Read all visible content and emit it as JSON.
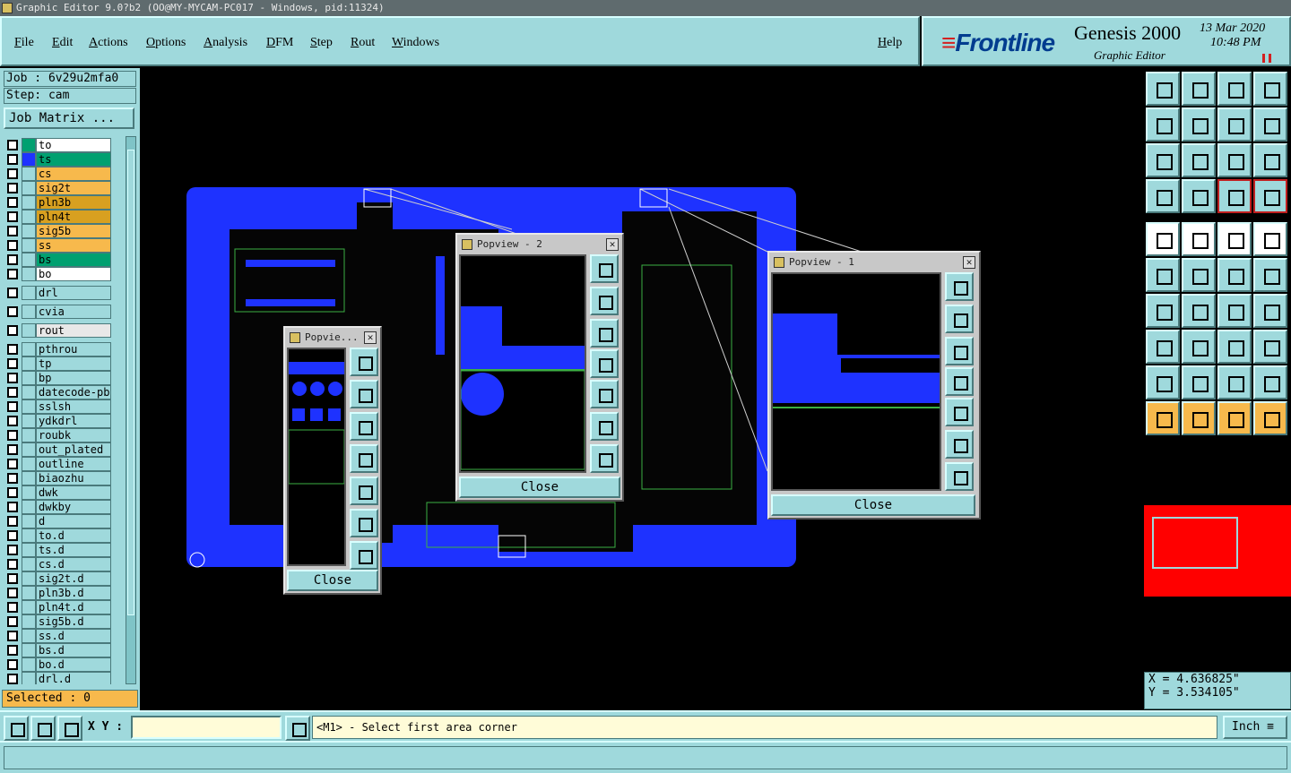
{
  "window": {
    "title": "Graphic Editor 9.0?b2 (OO@MY-MYCAM-PC017 - Windows, pid:11324)"
  },
  "menu": {
    "items": [
      "File",
      "Edit",
      "Actions",
      "Options",
      "Analysis",
      "DFM",
      "Step",
      "Rout",
      "Windows"
    ],
    "help": "Help"
  },
  "brand": {
    "logo": "Frontline",
    "product": "Genesis 2000",
    "subtitle": "Graphic Editor",
    "date": "13 Mar 2020",
    "time": "10:48 PM"
  },
  "job": {
    "label": "Job : 6v29u2mfa0",
    "step": "Step: cam",
    "matrix_button": "Job Matrix ..."
  },
  "layers": [
    {
      "name": "to",
      "color": "#ffffff",
      "swatch": "#00a070"
    },
    {
      "name": "ts",
      "color": "#00a070",
      "swatch": "#1e32ff"
    },
    {
      "name": "cs",
      "color": "#f7b94c",
      "swatch": ""
    },
    {
      "name": "sig2t",
      "color": "#f7b94c",
      "swatch": ""
    },
    {
      "name": "pln3b",
      "color": "#d8a020",
      "swatch": ""
    },
    {
      "name": "pln4t",
      "color": "#d8a020",
      "swatch": ""
    },
    {
      "name": "sig5b",
      "color": "#f7b94c",
      "swatch": ""
    },
    {
      "name": "ss",
      "color": "#f7b94c",
      "swatch": ""
    },
    {
      "name": "bs",
      "color": "#00a070",
      "swatch": ""
    },
    {
      "name": "bo",
      "color": "#ffffff",
      "swatch": ""
    },
    {
      "name": "drl",
      "color": "#9fd9dc",
      "swatch": ""
    },
    {
      "name": "cvia",
      "color": "#9fd9dc",
      "swatch": ""
    },
    {
      "name": "rout",
      "color": "#e8e8e8",
      "swatch": ""
    },
    {
      "name": "pthrou",
      "color": "#9fd9dc",
      "swatch": ""
    },
    {
      "name": "tp",
      "color": "#9fd9dc",
      "swatch": ""
    },
    {
      "name": "bp",
      "color": "#9fd9dc",
      "swatch": ""
    },
    {
      "name": "datecode-pb",
      "color": "#9fd9dc",
      "swatch": ""
    },
    {
      "name": "sslsh",
      "color": "#9fd9dc",
      "swatch": ""
    },
    {
      "name": "ydkdrl",
      "color": "#9fd9dc",
      "swatch": ""
    },
    {
      "name": "roubk",
      "color": "#9fd9dc",
      "swatch": ""
    },
    {
      "name": "out_plated",
      "color": "#9fd9dc",
      "swatch": ""
    },
    {
      "name": "outline",
      "color": "#9fd9dc",
      "swatch": ""
    },
    {
      "name": "biaozhu",
      "color": "#9fd9dc",
      "swatch": ""
    },
    {
      "name": "dwk",
      "color": "#9fd9dc",
      "swatch": ""
    },
    {
      "name": "dwkby",
      "color": "#9fd9dc",
      "swatch": ""
    },
    {
      "name": "d",
      "color": "#9fd9dc",
      "swatch": ""
    },
    {
      "name": "to.d",
      "color": "#9fd9dc",
      "swatch": ""
    },
    {
      "name": "ts.d",
      "color": "#9fd9dc",
      "swatch": ""
    },
    {
      "name": "cs.d",
      "color": "#9fd9dc",
      "swatch": ""
    },
    {
      "name": "sig2t.d",
      "color": "#9fd9dc",
      "swatch": ""
    },
    {
      "name": "pln3b.d",
      "color": "#9fd9dc",
      "swatch": ""
    },
    {
      "name": "pln4t.d",
      "color": "#9fd9dc",
      "swatch": ""
    },
    {
      "name": "sig5b.d",
      "color": "#9fd9dc",
      "swatch": ""
    },
    {
      "name": "ss.d",
      "color": "#9fd9dc",
      "swatch": ""
    },
    {
      "name": "bs.d",
      "color": "#9fd9dc",
      "swatch": ""
    },
    {
      "name": "bo.d",
      "color": "#9fd9dc",
      "swatch": ""
    },
    {
      "name": "drl.d",
      "color": "#9fd9dc",
      "swatch": ""
    }
  ],
  "selected": "Selected : 0",
  "popviews": [
    {
      "title": "Popvie...",
      "close": "Close"
    },
    {
      "title": "Popview - 2",
      "close": "Close"
    },
    {
      "title": "Popview - 1",
      "close": "Close"
    }
  ],
  "coords": {
    "x": "X = 4.636825\"",
    "y": "Y = 3.534105\""
  },
  "status": {
    "xy_label": "X Y :",
    "xy_value": "",
    "message": "<M1> - Select first area corner",
    "unit": "Inch"
  },
  "colors": {
    "accent": "#9fd9dc",
    "board": "#1e32ff",
    "highlight": "#f7b94c",
    "silk": "#3cb043"
  }
}
